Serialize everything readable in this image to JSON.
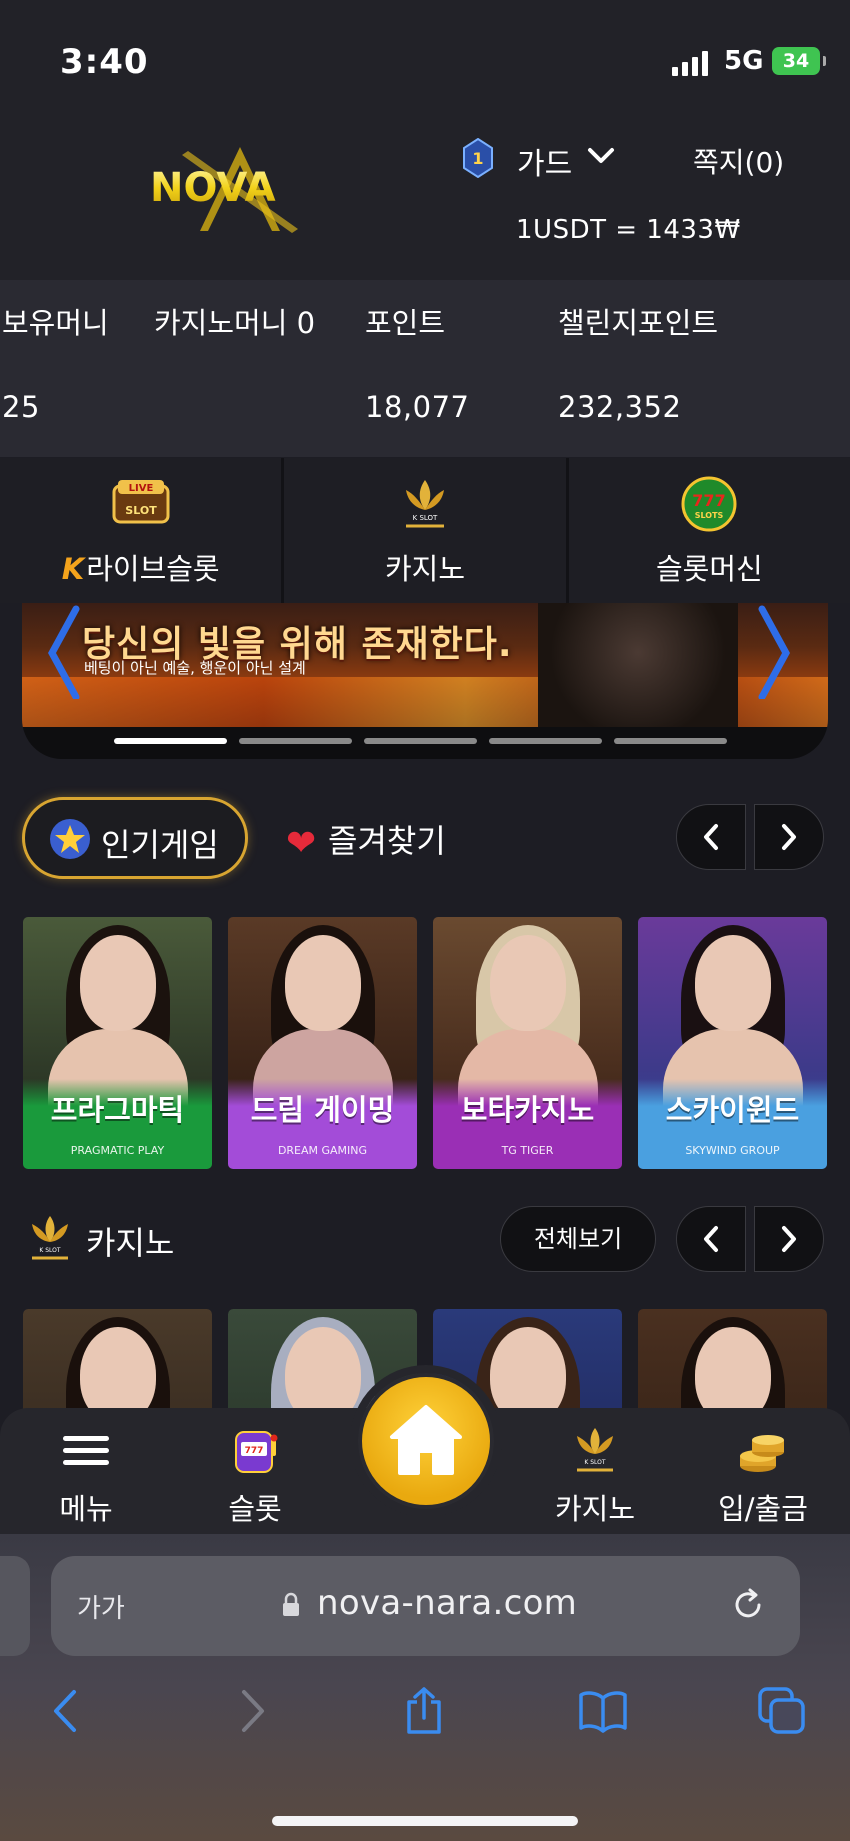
{
  "status_bar": {
    "time": "3:40",
    "network": "5G",
    "battery": "34"
  },
  "header": {
    "logo_text": "NOVA",
    "rank": "1",
    "user_name": "가드",
    "messages": "쪽지(0)",
    "rate": "1USDT = 1433₩"
  },
  "balances": {
    "holding_label": "보유머니",
    "holding_value": "25",
    "casino_label": "카지노머니 0",
    "points_label": "포인트",
    "points_value": "18,077",
    "challenge_label": "챌린지포인트",
    "challenge_value": "232,352"
  },
  "categories": [
    {
      "label": "라이브슬롯",
      "prefix": "K",
      "icon": "live-slot-icon",
      "icon_text": "LIVE SLOT"
    },
    {
      "label": "카지노",
      "icon": "k-slot-lotus-icon",
      "icon_text": "K SLOT"
    },
    {
      "label": "슬롯머신",
      "icon": "777-slots-icon",
      "icon_text": "777 SLOTS"
    }
  ],
  "banner": {
    "title": "당신의 빛을 위해 존재한다.",
    "subtitle": "베팅이 아닌 예술, 행운이 아닌 설계",
    "slides": 5,
    "active_slide": 1
  },
  "game_tabs": {
    "popular": "인기게임",
    "favorites": "즐겨찾기"
  },
  "providers": [
    {
      "title": "프라그마틱",
      "brand": "PRAGMATIC PLAY",
      "color": "#1a9a3c"
    },
    {
      "title": "드림 게이밍",
      "brand": "DREAM GAMING",
      "color": "#a34cd8"
    },
    {
      "title": "보타카지노",
      "brand": "TG TIGER",
      "color": "#9a2fb5"
    },
    {
      "title": "스카이윈드",
      "brand": "SKYWIND GROUP",
      "color": "#4aa0e0"
    }
  ],
  "casino_section": {
    "title": "카지노",
    "see_all": "전체보기",
    "icon_text": "K SLOT"
  },
  "bottom_nav": {
    "menu": "메뉴",
    "slot": "슬롯",
    "casino": "카지노",
    "casino_icon_text": "K SLOT",
    "deposit": "입/출금"
  },
  "browser": {
    "text_size": "가가",
    "url": "nova-nara.com"
  },
  "colors": {
    "gold": "#d8a531",
    "background": "#1d1d24",
    "accent_blue": "#3a7bd5"
  }
}
